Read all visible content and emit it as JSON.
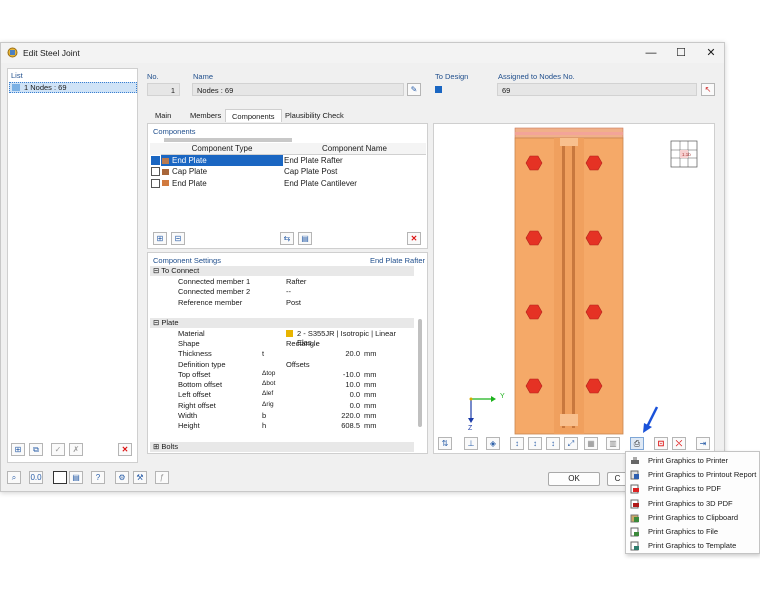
{
  "window": {
    "title": "Edit Steel Joint"
  },
  "list": {
    "label": "List",
    "items": [
      {
        "text": "1  Nodes : 69"
      }
    ]
  },
  "fields": {
    "no_label": "No.",
    "no_value": "1",
    "name_label": "Name",
    "name_value": "Nodes : 69",
    "to_design_label": "To Design",
    "assigned_label": "Assigned to Nodes No.",
    "assigned_value": "69"
  },
  "tabs": [
    "Main",
    "Members",
    "Components",
    "Plausibility Check"
  ],
  "components": {
    "title": "Components",
    "col_type": "Component Type",
    "col_name": "Component Name",
    "rows": [
      {
        "type": "End Plate",
        "name": "End Plate Rafter",
        "checked": true,
        "color": "#b87a50",
        "selected": true
      },
      {
        "type": "Cap Plate",
        "name": "Cap Plate Post",
        "checked": false,
        "color": "#a8663a",
        "selected": false
      },
      {
        "type": "End Plate",
        "name": "End Plate Cantilever",
        "checked": false,
        "color": "#d17a3e",
        "selected": false
      }
    ]
  },
  "settings": {
    "title": "Component Settings",
    "subtitle": "End Plate Rafter",
    "group1": "To Connect",
    "group1_rows": [
      {
        "label": "Connected member 1",
        "sym": "",
        "value": "Rafter",
        "unit": ""
      },
      {
        "label": "Connected member 2",
        "sym": "",
        "value": "--",
        "unit": ""
      },
      {
        "label": "Reference member",
        "sym": "",
        "value": "Post",
        "unit": ""
      }
    ],
    "group2": "Plate",
    "material_label": "Material",
    "material_value": "2 - S355JR | Isotropic | Linear Elas...",
    "group2_rows": [
      {
        "label": "Shape",
        "sym": "",
        "value": "Rectangle",
        "unit": ""
      },
      {
        "label": "Thickness",
        "sym": "t",
        "value": "20.0",
        "unit": "mm"
      },
      {
        "label": "Definition type",
        "sym": "",
        "value": "Offsets",
        "unit": ""
      },
      {
        "label": "Top offset",
        "sym": "Δtop",
        "value": "-10.0",
        "unit": "mm"
      },
      {
        "label": "Bottom offset",
        "sym": "Δbot",
        "value": "10.0",
        "unit": "mm"
      },
      {
        "label": "Left offset",
        "sym": "Δlef",
        "value": "0.0",
        "unit": "mm"
      },
      {
        "label": "Right offset",
        "sym": "Δrig",
        "value": "0.0",
        "unit": "mm"
      },
      {
        "label": "Width",
        "sym": "b",
        "value": "220.0",
        "unit": "mm"
      },
      {
        "label": "Height",
        "sym": "h",
        "value": "608.5",
        "unit": "mm"
      }
    ],
    "group3": "Bolts"
  },
  "viewport": {
    "axis_y": "Y",
    "axis_z": "Z",
    "mini_label": "1.1b"
  },
  "buttons": {
    "ok": "OK",
    "cancel": "C"
  },
  "print_menu": [
    "Print Graphics to Printer",
    "Print Graphics to Printout Report",
    "Print Graphics to PDF",
    "Print Graphics to 3D PDF",
    "Print Graphics to Clipboard",
    "Print Graphics to File",
    "Print Graphics to Template"
  ],
  "colors": {
    "accent": "#1a66c2",
    "plate": "#f5a968",
    "bolt": "#e53224",
    "selection": "#cfe3f7"
  }
}
